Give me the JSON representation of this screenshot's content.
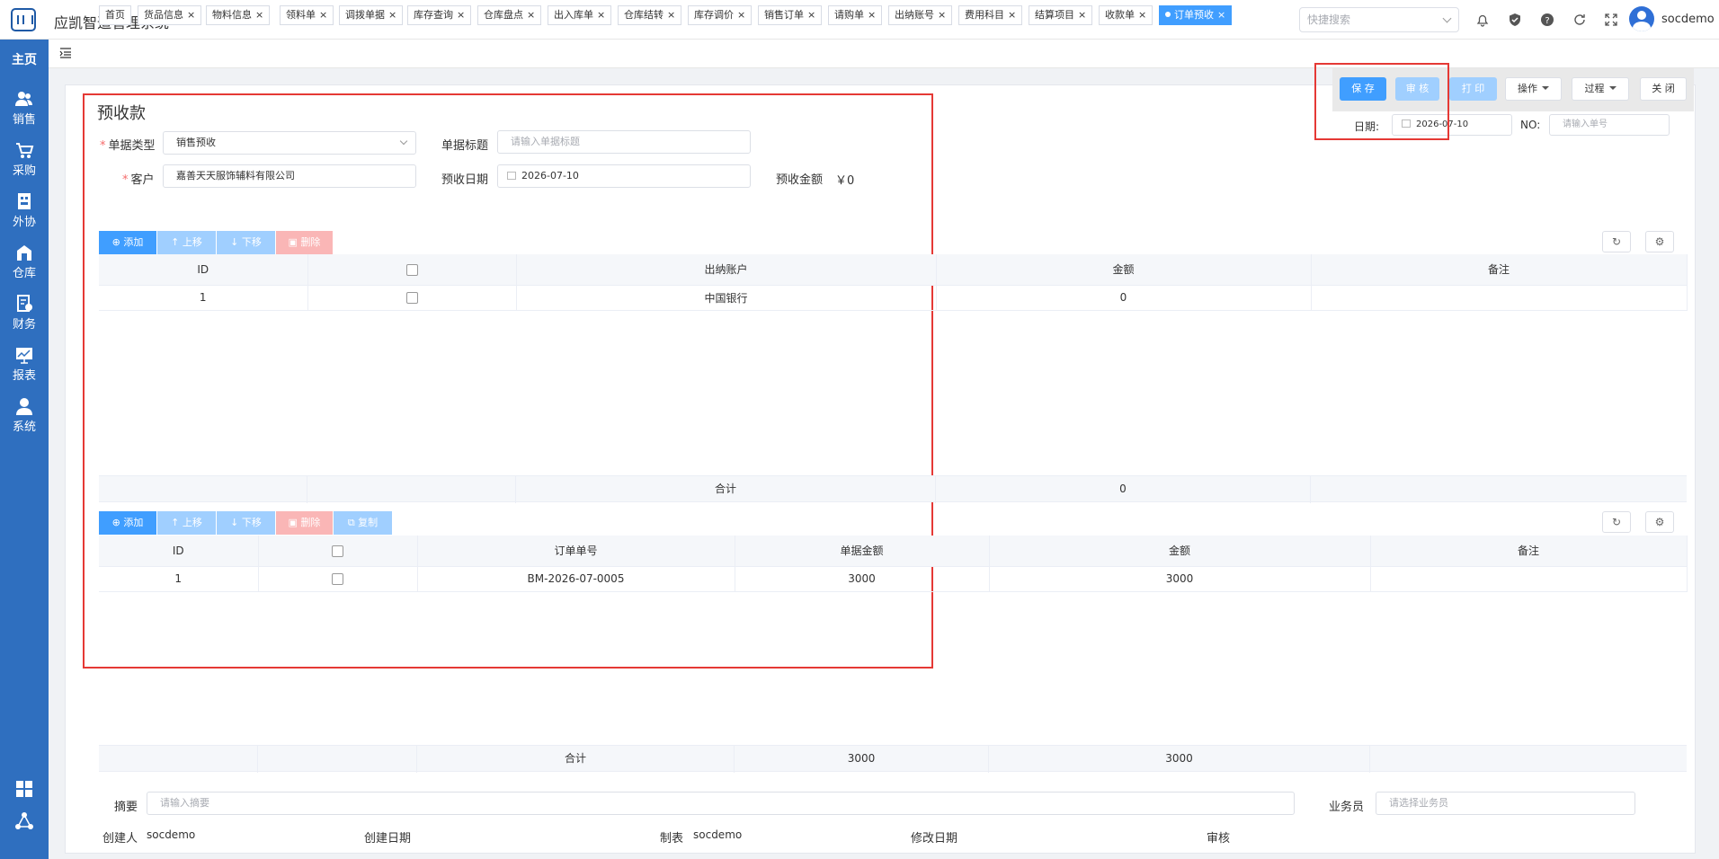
{
  "app": {
    "title": "应凯智造管理系统",
    "search_placeholder": "快捷搜索",
    "username": "socdemo"
  },
  "sidebar": {
    "home": "主页",
    "items": [
      {
        "label": "销售",
        "icon": "users-icon"
      },
      {
        "label": "采购",
        "icon": "cart-icon"
      },
      {
        "label": "外协",
        "icon": "outsource-icon"
      },
      {
        "label": "仓库",
        "icon": "warehouse-icon"
      },
      {
        "label": "财务",
        "icon": "finance-icon"
      },
      {
        "label": "报表",
        "icon": "chart-icon"
      },
      {
        "label": "系统",
        "icon": "user-icon"
      }
    ]
  },
  "tabs": [
    "首页",
    "货品信息",
    "物料信息",
    "领料单",
    "调拨单据",
    "库存查询",
    "仓库盘点",
    "出入库单",
    "仓库结转",
    "库存调价",
    "销售订单",
    "请购单",
    "出纳账号",
    "费用科目",
    "结算项目",
    "收款单",
    "订单预收"
  ],
  "toolbar": {
    "save": "保 存",
    "audit": "审 核",
    "print": "打 印",
    "operate": "操作",
    "process": "过程",
    "close": "关 闭",
    "date_label": "日期:",
    "date_value": "2026-07-10",
    "no_label": "NO:",
    "no_placeholder": "请输入单号"
  },
  "form": {
    "title": "预收款",
    "doc_type_label": "单据类型",
    "doc_type_value": "销售预收",
    "doc_title_label": "单据标题",
    "doc_title_placeholder": "请输入单据标题",
    "customer_label": "客户",
    "customer_value": "嘉善天天服饰辅料有限公司",
    "receipt_date_label": "预收日期",
    "receipt_date_value": "2026-07-10",
    "amount_label": "预收金额",
    "amount_value": "￥0"
  },
  "grid_buttons": {
    "add": "⊕ 添加",
    "up": "↑ 上移",
    "down": "↓ 下移",
    "delete": "删除",
    "copy": "复制"
  },
  "accounts_table": {
    "headers": [
      "ID",
      "",
      "出纳账户",
      "金额",
      "备注"
    ],
    "rows": [
      {
        "id": "1",
        "account": "中国银行",
        "amount": "0",
        "remark": ""
      }
    ],
    "footer_label": "合计",
    "footer_amount": "0"
  },
  "orders_table": {
    "headers": [
      "ID",
      "",
      "订单单号",
      "单据金额",
      "金额",
      "备注"
    ],
    "rows": [
      {
        "id": "1",
        "order_no": "BM-2026-07-0005",
        "doc_amount": "3000",
        "amount": "3000",
        "remark": ""
      }
    ],
    "footer_label": "合计",
    "footer_doc_amount": "3000",
    "footer_amount": "3000"
  },
  "bottom": {
    "summary_label": "摘要",
    "summary_placeholder": "请输入摘要",
    "salesman_label": "业务员",
    "salesman_placeholder": "请选择业务员",
    "creator_label": "创建人",
    "creator_value": "socdemo",
    "created_date_label": "创建日期",
    "maker_label": "制表",
    "maker_value": "socdemo",
    "modified_date_label": "修改日期",
    "auditor_label": "审核"
  }
}
